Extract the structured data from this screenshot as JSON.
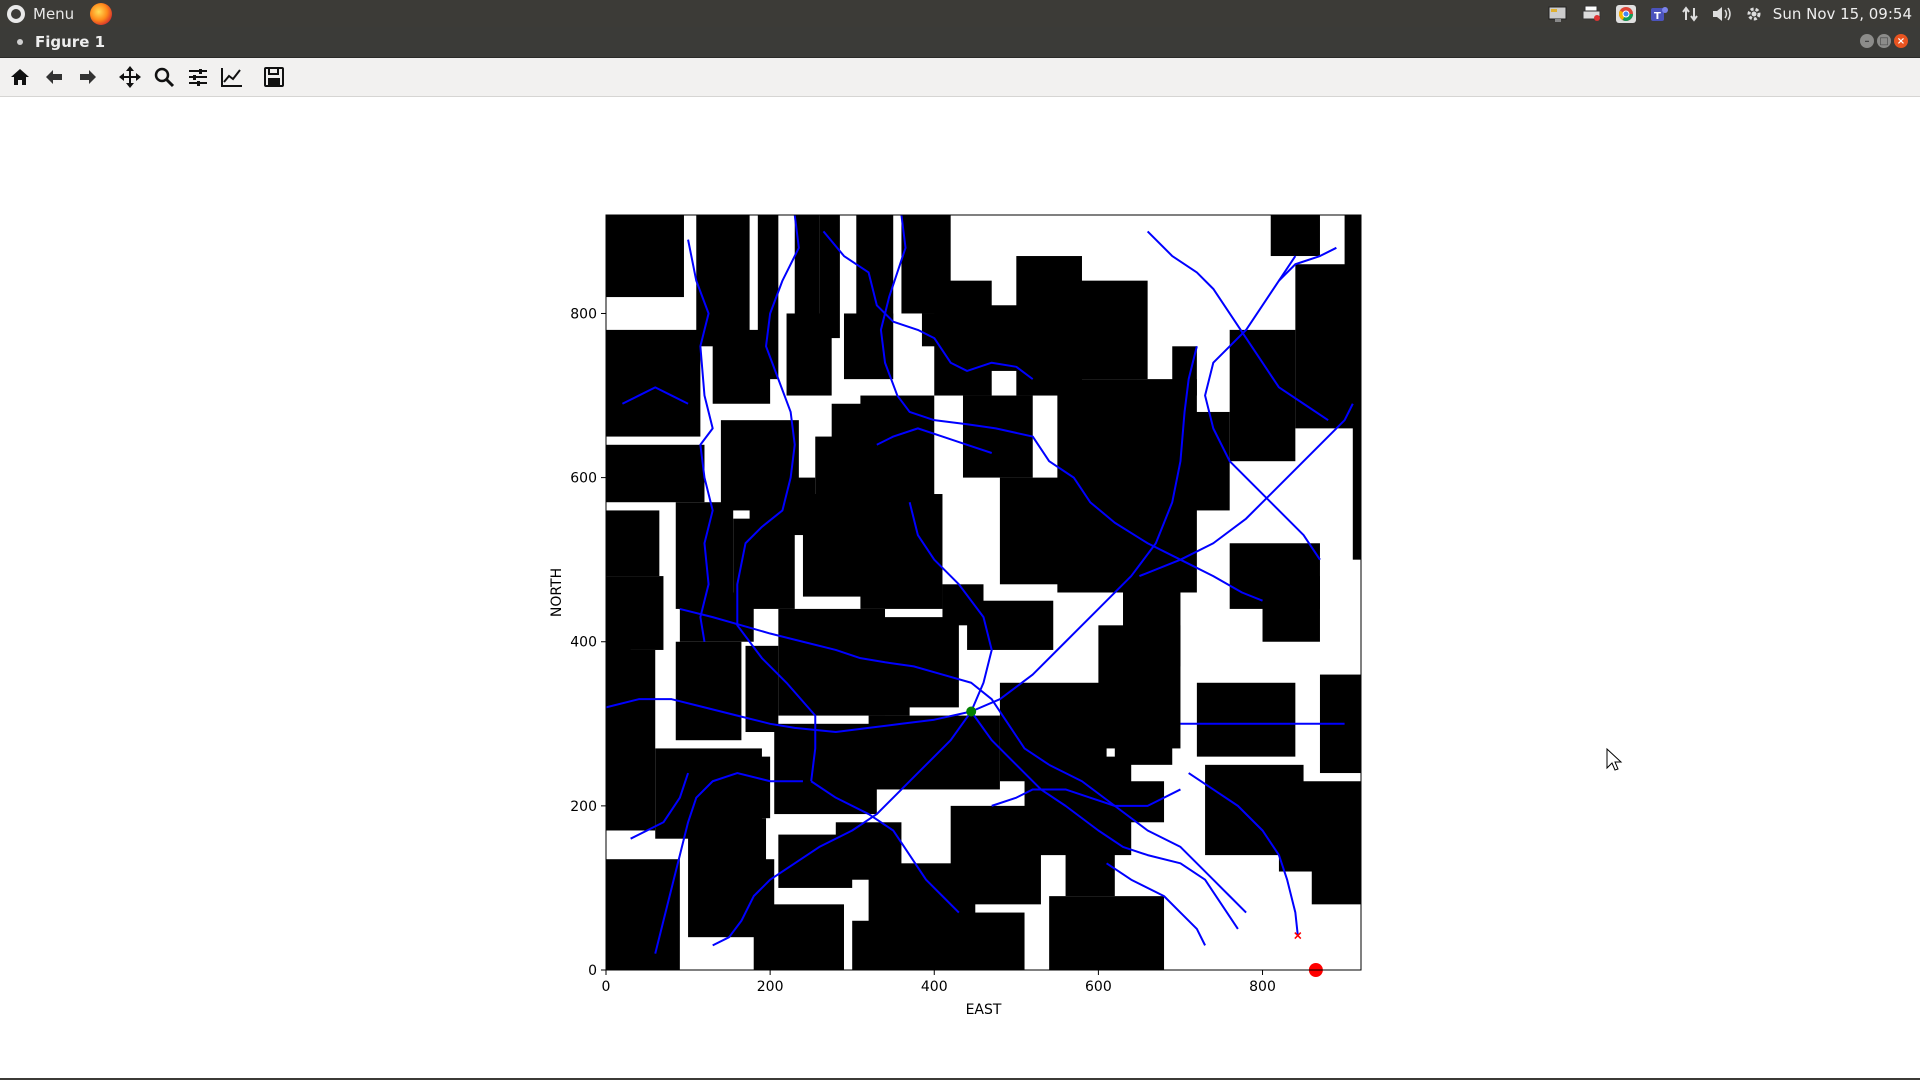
{
  "system_panel": {
    "menu_label": "Menu",
    "clock": "Sun Nov 15, 09:54",
    "tray_icons": [
      "monitor-icon",
      "printer-icon",
      "chrome-icon",
      "teams-icon",
      "network-icon",
      "volume-icon",
      "settings-icon"
    ]
  },
  "window": {
    "title": "Figure 1"
  },
  "toolbar": {
    "buttons": [
      "home-icon",
      "back-icon",
      "forward-icon",
      "pan-icon",
      "zoom-icon",
      "configure-subplots-icon",
      "edit-axis-icon",
      "save-icon"
    ]
  },
  "colors": {
    "obstacle": "#000000",
    "path": "#0000ff",
    "start_marker": "#008000",
    "goal_marker": "#ff0000",
    "panel": "#3c3b37"
  },
  "chart_data": {
    "type": "scatter",
    "title": "",
    "xlabel": "EAST",
    "ylabel": "NORTH",
    "xlim": [
      0,
      920
    ],
    "ylim": [
      0,
      920
    ],
    "x_ticks": [
      "0",
      "200",
      "400",
      "600",
      "800"
    ],
    "y_ticks": [
      "0",
      "200",
      "400",
      "600",
      "800"
    ],
    "tick_values": [
      0,
      200,
      400,
      600,
      800
    ],
    "grid": false,
    "points": [
      {
        "name": "start",
        "x": 445,
        "y": 315,
        "marker": "o",
        "color": "#008000"
      },
      {
        "name": "goal",
        "x": 843,
        "y": 42,
        "marker": "x",
        "color": "#ff0000"
      },
      {
        "name": "start-large",
        "x": 865,
        "y": 0,
        "marker": "o",
        "color": "#ff0000"
      }
    ],
    "obstacles": [
      [
        0,
        820,
        95,
        920
      ],
      [
        110,
        760,
        175,
        920
      ],
      [
        185,
        720,
        210,
        920
      ],
      [
        230,
        770,
        260,
        920
      ],
      [
        260,
        770,
        285,
        920
      ],
      [
        305,
        750,
        335,
        920
      ],
      [
        330,
        790,
        350,
        920
      ],
      [
        360,
        800,
        420,
        920
      ],
      [
        385,
        760,
        420,
        800
      ],
      [
        0,
        650,
        115,
        780
      ],
      [
        130,
        690,
        200,
        780
      ],
      [
        220,
        700,
        275,
        800
      ],
      [
        290,
        720,
        350,
        800
      ],
      [
        0,
        570,
        120,
        640
      ],
      [
        140,
        560,
        235,
        670
      ],
      [
        255,
        565,
        290,
        650
      ],
      [
        275,
        530,
        350,
        690
      ],
      [
        0,
        480,
        65,
        560
      ],
      [
        85,
        440,
        155,
        570
      ],
      [
        175,
        530,
        255,
        600
      ],
      [
        310,
        550,
        400,
        700
      ],
      [
        340,
        605,
        375,
        640
      ],
      [
        435,
        600,
        520,
        700
      ],
      [
        480,
        470,
        560,
        600
      ],
      [
        0,
        390,
        70,
        480
      ],
      [
        90,
        400,
        180,
        460
      ],
      [
        155,
        440,
        230,
        550
      ],
      [
        240,
        455,
        320,
        580
      ],
      [
        310,
        440,
        410,
        580
      ],
      [
        210,
        310,
        340,
        440
      ],
      [
        0,
        170,
        60,
        390
      ],
      [
        85,
        280,
        165,
        400
      ],
      [
        170,
        290,
        210,
        395
      ],
      [
        335,
        320,
        430,
        430
      ],
      [
        320,
        310,
        370,
        350
      ],
      [
        440,
        390,
        545,
        450
      ],
      [
        0,
        0,
        90,
        135
      ],
      [
        100,
        40,
        195,
        185
      ],
      [
        130,
        185,
        200,
        260
      ],
      [
        60,
        160,
        190,
        270
      ],
      [
        205,
        190,
        330,
        300
      ],
      [
        170,
        70,
        205,
        135
      ],
      [
        210,
        100,
        300,
        165
      ],
      [
        340,
        240,
        415,
        300
      ],
      [
        410,
        420,
        460,
        470
      ],
      [
        550,
        460,
        720,
        720
      ],
      [
        630,
        370,
        700,
        460
      ],
      [
        720,
        260,
        840,
        350
      ],
      [
        620,
        250,
        690,
        340
      ],
      [
        730,
        140,
        850,
        250
      ],
      [
        820,
        120,
        920,
        230
      ],
      [
        540,
        0,
        680,
        90
      ],
      [
        560,
        90,
        620,
        150
      ],
      [
        620,
        180,
        680,
        230
      ],
      [
        600,
        270,
        700,
        420
      ],
      [
        480,
        230,
        610,
        350
      ],
      [
        510,
        140,
        640,
        260
      ],
      [
        320,
        220,
        480,
        310
      ],
      [
        420,
        80,
        530,
        200
      ],
      [
        320,
        40,
        450,
        130
      ],
      [
        280,
        110,
        360,
        180
      ],
      [
        180,
        0,
        290,
        80
      ],
      [
        300,
        0,
        390,
        60
      ],
      [
        380,
        0,
        510,
        70
      ],
      [
        860,
        80,
        920,
        220
      ],
      [
        870,
        240,
        920,
        360
      ],
      [
        0,
        500,
        30,
        540
      ],
      [
        690,
        560,
        760,
        680
      ],
      [
        760,
        440,
        870,
        520
      ],
      [
        910,
        500,
        920,
        700
      ],
      [
        760,
        620,
        840,
        780
      ],
      [
        840,
        660,
        920,
        860
      ],
      [
        500,
        700,
        580,
        870
      ],
      [
        570,
        720,
        660,
        840
      ],
      [
        400,
        700,
        470,
        840
      ],
      [
        450,
        730,
        540,
        810
      ],
      [
        690,
        700,
        720,
        760
      ],
      [
        800,
        400,
        870,
        480
      ],
      [
        810,
        870,
        870,
        920
      ],
      [
        900,
        850,
        920,
        920
      ],
      [
        0,
        30,
        40,
        100
      ],
      [
        0,
        380,
        30,
        440
      ]
    ],
    "paths": [
      [
        [
          100,
          890
        ],
        [
          110,
          840
        ],
        [
          125,
          800
        ],
        [
          115,
          760
        ],
        [
          120,
          700
        ],
        [
          130,
          660
        ],
        [
          115,
          640
        ],
        [
          120,
          600
        ],
        [
          130,
          560
        ],
        [
          120,
          520
        ],
        [
          125,
          470
        ],
        [
          115,
          430
        ],
        [
          120,
          400
        ]
      ],
      [
        [
          230,
          920
        ],
        [
          235,
          880
        ],
        [
          215,
          840
        ],
        [
          200,
          800
        ],
        [
          195,
          760
        ],
        [
          210,
          720
        ],
        [
          225,
          680
        ],
        [
          230,
          640
        ],
        [
          225,
          600
        ],
        [
          215,
          560
        ],
        [
          190,
          540
        ],
        [
          170,
          520
        ],
        [
          160,
          470
        ],
        [
          160,
          420
        ],
        [
          190,
          380
        ],
        [
          220,
          350
        ],
        [
          255,
          310
        ],
        [
          255,
          270
        ],
        [
          250,
          230
        ]
      ],
      [
        [
          265,
          900
        ],
        [
          290,
          870
        ],
        [
          320,
          850
        ],
        [
          330,
          810
        ],
        [
          350,
          790
        ],
        [
          380,
          780
        ],
        [
          400,
          770
        ],
        [
          420,
          740
        ],
        [
          440,
          730
        ],
        [
          470,
          740
        ],
        [
          500,
          735
        ],
        [
          520,
          720
        ]
      ],
      [
        [
          360,
          920
        ],
        [
          365,
          880
        ],
        [
          355,
          850
        ],
        [
          345,
          820
        ],
        [
          335,
          780
        ],
        [
          340,
          740
        ],
        [
          355,
          700
        ],
        [
          370,
          680
        ],
        [
          400,
          670
        ],
        [
          440,
          665
        ],
        [
          475,
          660
        ],
        [
          520,
          650
        ],
        [
          540,
          620
        ],
        [
          570,
          600
        ],
        [
          590,
          570
        ],
        [
          620,
          545
        ],
        [
          660,
          520
        ],
        [
          700,
          500
        ],
        [
          740,
          480
        ],
        [
          775,
          460
        ],
        [
          800,
          450
        ]
      ],
      [
        [
          90,
          440
        ],
        [
          130,
          430
        ],
        [
          165,
          420
        ],
        [
          200,
          410
        ],
        [
          240,
          400
        ],
        [
          280,
          390
        ],
        [
          310,
          380
        ],
        [
          340,
          375
        ],
        [
          375,
          370
        ],
        [
          410,
          360
        ],
        [
          445,
          350
        ],
        [
          470,
          330
        ],
        [
          490,
          300
        ],
        [
          510,
          270
        ],
        [
          540,
          250
        ]
      ],
      [
        [
          0,
          320
        ],
        [
          40,
          330
        ],
        [
          80,
          330
        ],
        [
          120,
          320
        ],
        [
          160,
          310
        ],
        [
          200,
          300
        ],
        [
          230,
          295
        ],
        [
          280,
          290
        ],
        [
          320,
          295
        ],
        [
          360,
          300
        ],
        [
          400,
          305
        ],
        [
          445,
          315
        ],
        [
          480,
          330
        ],
        [
          520,
          360
        ],
        [
          560,
          400
        ],
        [
          600,
          440
        ],
        [
          640,
          480
        ],
        [
          670,
          520
        ],
        [
          690,
          570
        ],
        [
          700,
          620
        ],
        [
          705,
          680
        ],
        [
          710,
          720
        ],
        [
          720,
          760
        ]
      ],
      [
        [
          445,
          315
        ],
        [
          420,
          280
        ],
        [
          390,
          250
        ],
        [
          360,
          220
        ],
        [
          330,
          190
        ],
        [
          300,
          170
        ],
        [
          260,
          150
        ],
        [
          230,
          130
        ],
        [
          200,
          110
        ],
        [
          180,
          90
        ],
        [
          165,
          60
        ],
        [
          150,
          40
        ],
        [
          130,
          30
        ]
      ],
      [
        [
          445,
          315
        ],
        [
          470,
          280
        ],
        [
          500,
          250
        ],
        [
          530,
          220
        ],
        [
          560,
          200
        ],
        [
          600,
          170
        ],
        [
          630,
          150
        ],
        [
          660,
          140
        ],
        [
          700,
          130
        ],
        [
          730,
          110
        ],
        [
          750,
          80
        ],
        [
          770,
          50
        ]
      ],
      [
        [
          445,
          315
        ],
        [
          460,
          350
        ],
        [
          470,
          390
        ],
        [
          460,
          430
        ],
        [
          430,
          470
        ],
        [
          400,
          500
        ],
        [
          380,
          530
        ],
        [
          370,
          570
        ]
      ],
      [
        [
          540,
          250
        ],
        [
          580,
          230
        ],
        [
          620,
          200
        ],
        [
          660,
          170
        ],
        [
          700,
          150
        ],
        [
          720,
          130
        ],
        [
          740,
          110
        ],
        [
          760,
          90
        ],
        [
          780,
          70
        ]
      ],
      [
        [
          700,
          300
        ],
        [
          740,
          300
        ],
        [
          780,
          300
        ],
        [
          820,
          300
        ],
        [
          860,
          300
        ],
        [
          900,
          300
        ]
      ],
      [
        [
          710,
          240
        ],
        [
          740,
          220
        ],
        [
          770,
          200
        ],
        [
          800,
          170
        ],
        [
          820,
          140
        ],
        [
          830,
          110
        ],
        [
          840,
          70
        ],
        [
          843,
          42
        ]
      ],
      [
        [
          650,
          480
        ],
        [
          700,
          500
        ],
        [
          740,
          520
        ],
        [
          780,
          550
        ],
        [
          810,
          580
        ],
        [
          840,
          610
        ],
        [
          870,
          640
        ],
        [
          900,
          670
        ],
        [
          910,
          690
        ]
      ],
      [
        [
          610,
          130
        ],
        [
          640,
          110
        ],
        [
          680,
          90
        ],
        [
          700,
          70
        ],
        [
          720,
          50
        ],
        [
          730,
          30
        ]
      ],
      [
        [
          250,
          230
        ],
        [
          280,
          210
        ],
        [
          320,
          190
        ],
        [
          350,
          170
        ],
        [
          370,
          140
        ],
        [
          390,
          110
        ],
        [
          410,
          90
        ],
        [
          430,
          70
        ]
      ],
      [
        [
          60,
          20
        ],
        [
          70,
          60
        ],
        [
          80,
          100
        ],
        [
          90,
          140
        ],
        [
          100,
          180
        ],
        [
          110,
          210
        ],
        [
          130,
          230
        ],
        [
          160,
          240
        ],
        [
          200,
          230
        ],
        [
          240,
          230
        ]
      ],
      [
        [
          30,
          160
        ],
        [
          50,
          170
        ],
        [
          70,
          180
        ],
        [
          90,
          210
        ],
        [
          100,
          240
        ]
      ],
      [
        [
          470,
          200
        ],
        [
          500,
          210
        ],
        [
          520,
          220
        ],
        [
          560,
          220
        ],
        [
          590,
          210
        ],
        [
          620,
          200
        ],
        [
          660,
          200
        ],
        [
          700,
          220
        ]
      ],
      [
        [
          840,
          870
        ],
        [
          820,
          840
        ],
        [
          800,
          810
        ],
        [
          780,
          780
        ],
        [
          760,
          760
        ],
        [
          740,
          740
        ],
        [
          730,
          700
        ],
        [
          740,
          660
        ],
        [
          760,
          620
        ],
        [
          790,
          590
        ],
        [
          820,
          560
        ],
        [
          850,
          530
        ],
        [
          870,
          500
        ]
      ],
      [
        [
          660,
          900
        ],
        [
          690,
          870
        ],
        [
          720,
          850
        ],
        [
          740,
          830
        ],
        [
          760,
          800
        ],
        [
          780,
          770
        ],
        [
          800,
          740
        ],
        [
          820,
          710
        ],
        [
          850,
          690
        ],
        [
          880,
          670
        ]
      ],
      [
        [
          890,
          880
        ],
        [
          870,
          870
        ],
        [
          840,
          860
        ],
        [
          820,
          840
        ]
      ],
      [
        [
          20,
          690
        ],
        [
          40,
          700
        ],
        [
          60,
          710
        ],
        [
          80,
          700
        ],
        [
          100,
          690
        ]
      ],
      [
        [
          330,
          640
        ],
        [
          350,
          650
        ],
        [
          380,
          660
        ],
        [
          410,
          650
        ],
        [
          440,
          640
        ],
        [
          470,
          630
        ]
      ]
    ]
  }
}
